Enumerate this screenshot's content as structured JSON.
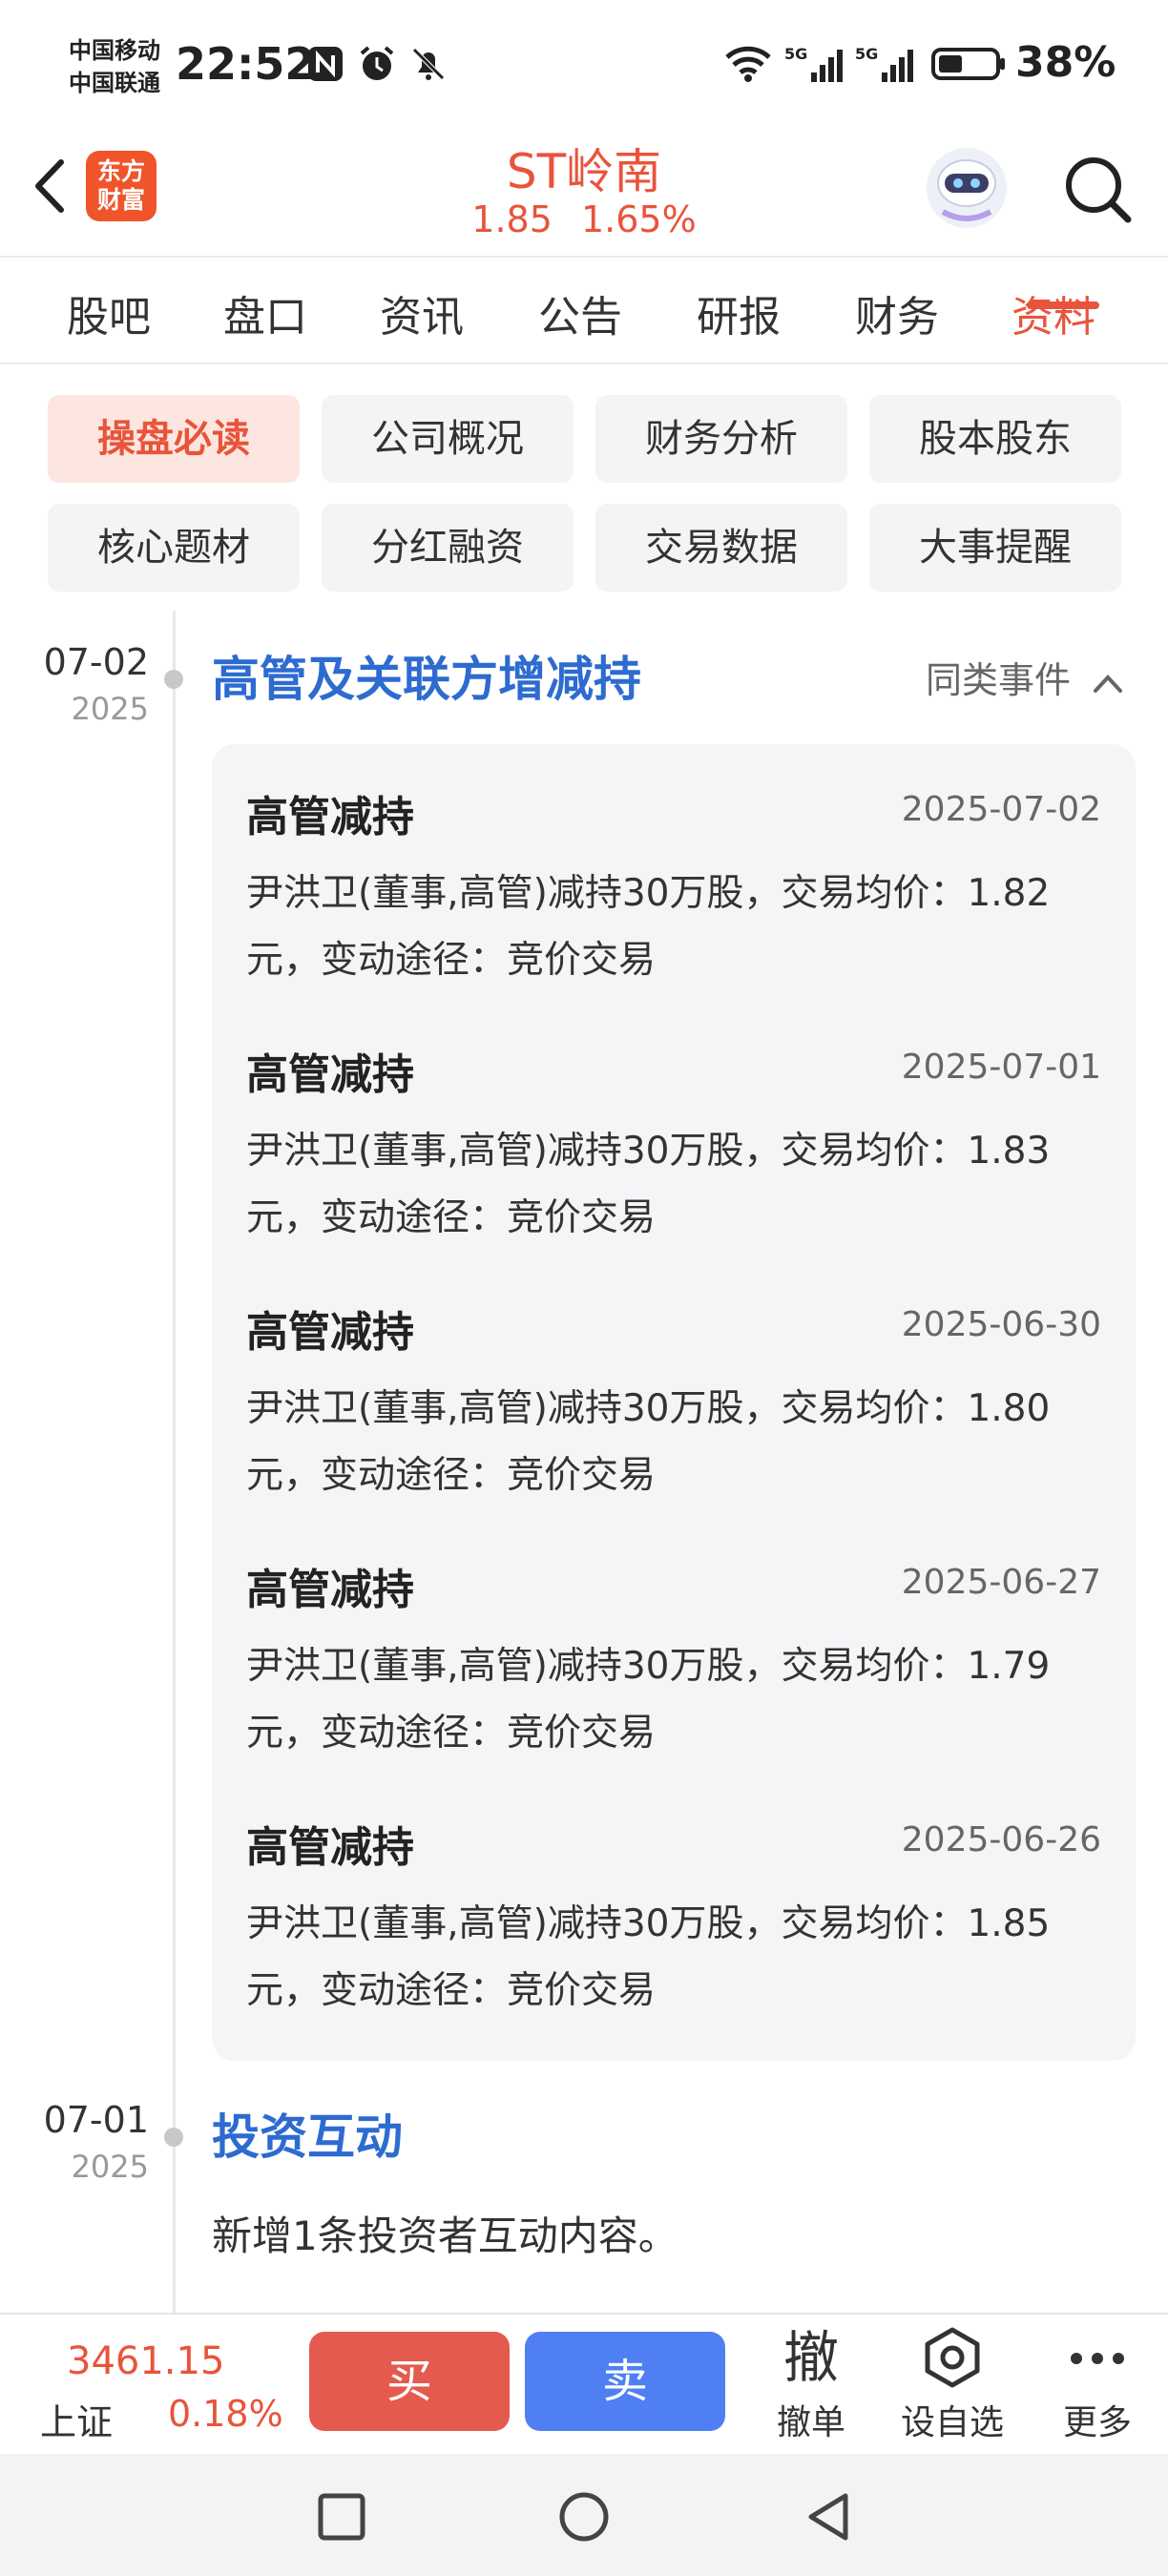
{
  "status_bar": {
    "carrier1": "中国移动",
    "carrier2": "中国联通",
    "time": "22:52",
    "battery": "38%",
    "icons": [
      "nfc-icon",
      "alarm-icon",
      "mute-icon",
      "wifi-icon",
      "5g-signal-icon",
      "5g-signal-icon",
      "battery-icon"
    ]
  },
  "header": {
    "logo_line1": "东方",
    "logo_line2": "财富",
    "stock_name": "ST岭南",
    "price_line": "1.85 1.65%",
    "accent": "#e8543b"
  },
  "tabs": [
    "股吧",
    "盘口",
    "资讯",
    "公告",
    "研报",
    "财务",
    "资料"
  ],
  "active_tab": "资料",
  "chips": [
    "操盘必读",
    "公司概况",
    "财务分析",
    "股本股东",
    "核心题材",
    "分红融资",
    "交易数据",
    "大事提醒"
  ],
  "active_chip": "操盘必读",
  "timeline": {
    "event1": {
      "date": "07-02",
      "year": "2025",
      "title": "高管及关联方增减持",
      "similar": "同类事件",
      "items": [
        {
          "title": "高管减持",
          "date": "2025-07-02",
          "body": "尹洪卫(董事,高管)减持30万股，交易均价：1.82元，变动途径：竞价交易"
        },
        {
          "title": "高管减持",
          "date": "2025-07-01",
          "body": "尹洪卫(董事,高管)减持30万股，交易均价：1.83元，变动途径：竞价交易"
        },
        {
          "title": "高管减持",
          "date": "2025-06-30",
          "body": "尹洪卫(董事,高管)减持30万股，交易均价：1.80元，变动途径：竞价交易"
        },
        {
          "title": "高管减持",
          "date": "2025-06-27",
          "body": "尹洪卫(董事,高管)减持30万股，交易均价：1.79元，变动途径：竞价交易"
        },
        {
          "title": "高管减持",
          "date": "2025-06-26",
          "body": "尹洪卫(董事,高管)减持30万股，交易均价：1.85元，变动途径：竞价交易"
        }
      ]
    },
    "event2": {
      "date": "07-01",
      "year": "2025",
      "title": "投资互动",
      "body": "新增1条投资者互动内容。"
    }
  },
  "bottom_bar": {
    "index_value": "3461.15",
    "index_name": "上证",
    "index_change": "0.18%",
    "buy": "买",
    "sell": "卖",
    "cancel_icon_char": "撤",
    "cancel_label": "撤单",
    "watch_label": "设自选",
    "more_label": "更多"
  }
}
